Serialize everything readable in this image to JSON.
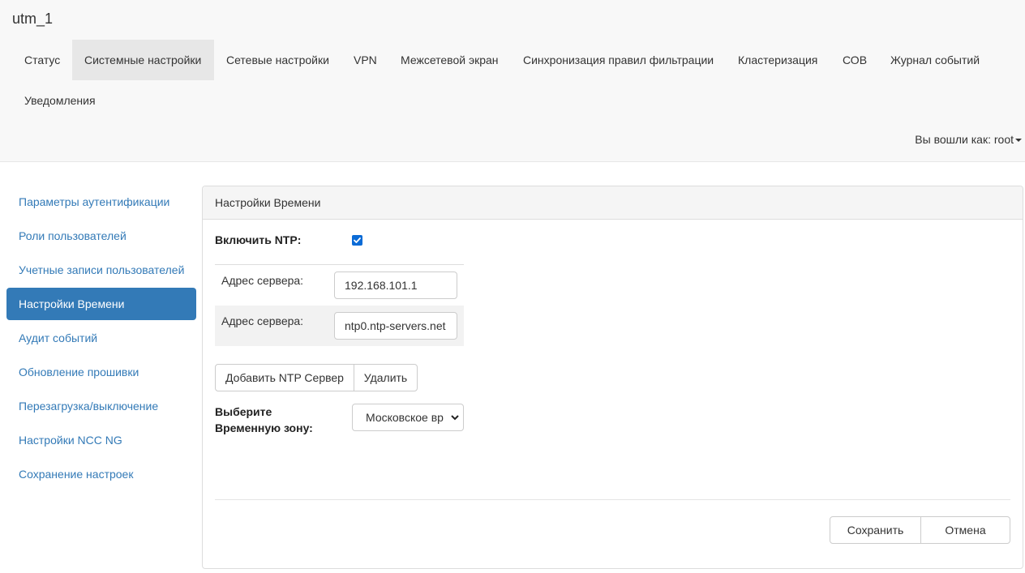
{
  "app": {
    "title": "utm_1"
  },
  "nav": {
    "items": [
      "Статус",
      "Системные настройки",
      "Сетевые настройки",
      "VPN",
      "Межсетевой экран",
      "Синхронизация правил фильтрации",
      "Кластеризация",
      "СОВ",
      "Журнал событий",
      "Уведомления"
    ],
    "active_index": 1
  },
  "user": {
    "label": "Вы вошли как: root"
  },
  "sidebar": {
    "items": [
      "Параметры аутентификации",
      "Роли пользователей",
      "Учетные записи пользователей",
      "Настройки Времени",
      "Аудит событий",
      "Обновление прошивки",
      "Перезагрузка/выключение",
      "Настройки NCC NG",
      "Сохранение настроек"
    ],
    "active_index": 3
  },
  "panel": {
    "title": "Настройки Времени",
    "ntp_label": "Включить NTP:",
    "ntp_enabled": true,
    "servers": [
      {
        "label": "Адрес сервера:",
        "value": "192.168.101.1"
      },
      {
        "label": "Адрес сервера:",
        "value": "ntp0.ntp-servers.net"
      }
    ],
    "add_button": "Добавить NTP Сервер",
    "delete_button": "Удалить",
    "timezone_label_line1": "Выберите",
    "timezone_label_line2": "Временную зону:",
    "timezone_value": "Московское вр",
    "save_button": "Сохранить",
    "cancel_button": "Отмена"
  },
  "colors": {
    "accent": "#337ab7",
    "checkbox": "#0b6bd6",
    "topbar_bg": "#f8f8f8",
    "active_nav_bg": "#e7e7e7"
  }
}
